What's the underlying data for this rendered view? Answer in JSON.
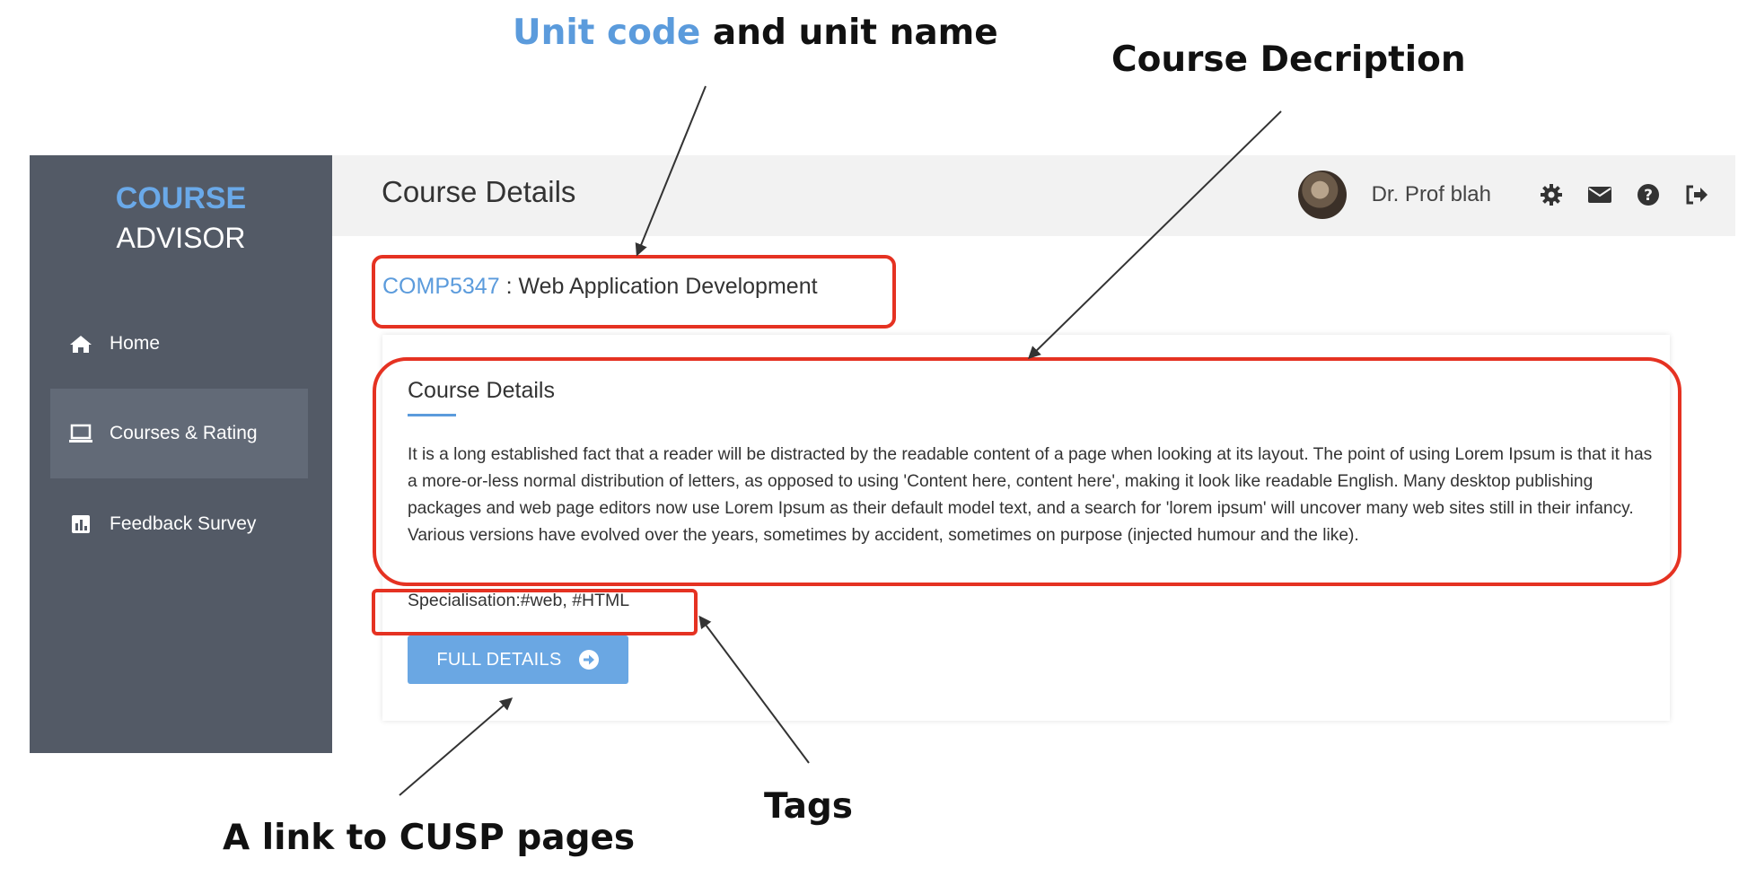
{
  "annotations": {
    "unit_code_part": "Unit code",
    "unit_name_part": " and unit name",
    "course_description": "Course Decription",
    "cusp_link": "A link to CUSP pages",
    "tags": "Tags"
  },
  "sidebar": {
    "brand_line1": "COURSE",
    "brand_line2": "ADVISOR",
    "items": [
      {
        "label": "Home",
        "icon": "home-icon"
      },
      {
        "label": "Courses & Rating",
        "icon": "laptop-icon",
        "active": true
      },
      {
        "label": "Feedback Survey",
        "icon": "bar-chart-icon"
      }
    ]
  },
  "header": {
    "title": "Course Details",
    "user_name": "Dr. Prof blah",
    "tools": [
      "gear-icon",
      "envelope-icon",
      "help-icon",
      "sign-out-icon"
    ]
  },
  "course": {
    "unit_code": "COMP5347",
    "unit_separator": " : ",
    "unit_name": "Web Application Development",
    "card_title": "Course Details",
    "description": "It is a long established fact that a reader will be distracted by the readable content of a page when looking at its layout. The point of using Lorem Ipsum is that it has a more-or-less normal distribution of letters, as opposed to using 'Content here, content here', making it look like readable English. Many desktop publishing packages and web page editors now use Lorem Ipsum as their default model text, and a search for 'lorem ipsum' will uncover many web sites still in their infancy. Various versions have evolved over the years, sometimes by accident, sometimes on purpose (injected humour and the like).",
    "specialisation": "Specialisation:#web, #HTML",
    "full_details_label": "FULL DETAILS"
  },
  "colors": {
    "accent": "#5b9bdc",
    "sidebar_bg": "#535a66",
    "sidebar_active": "#626a77",
    "highlight_box": "#e53222",
    "button": "#6aa7e3"
  }
}
